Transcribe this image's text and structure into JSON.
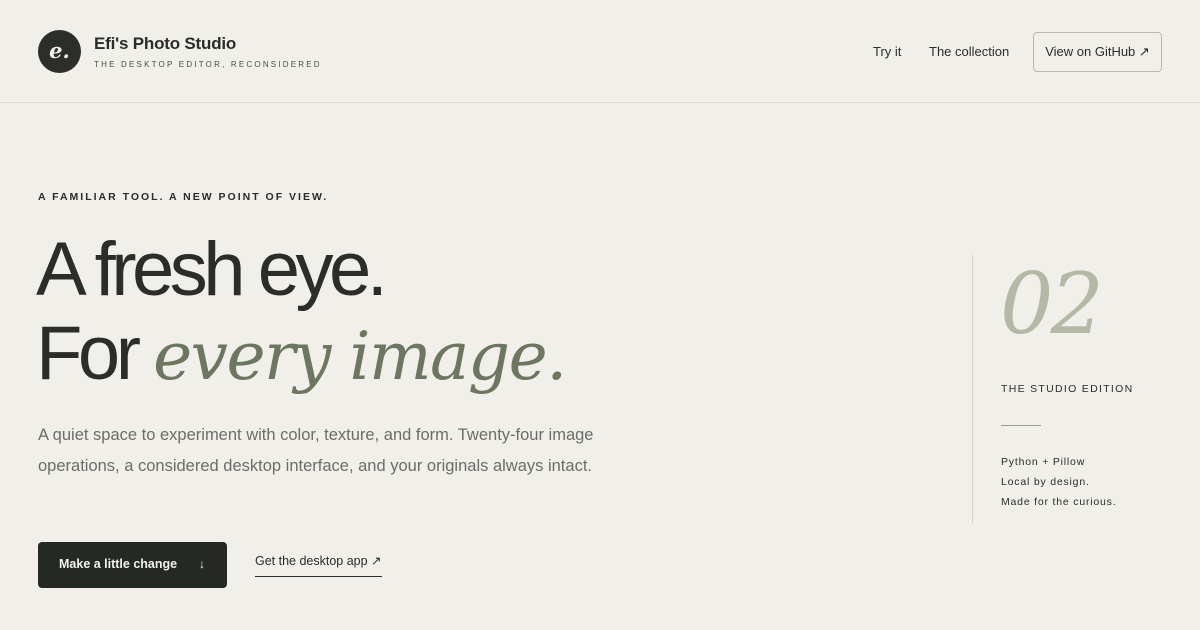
{
  "brand": {
    "logo_letter": "e.",
    "name": "Efi's Photo Studio",
    "tagline": "THE DESKTOP EDITOR, RECONSIDERED"
  },
  "nav": {
    "try_label": "Try it",
    "collection_label": "The collection",
    "github_label": "View on GitHub ↗"
  },
  "hero": {
    "eyebrow": "A FAMILIAR TOOL. A NEW POINT OF VIEW.",
    "headline_line1": "A fresh eye.",
    "headline_line2_plain": "For",
    "headline_line2_accent": "every image.",
    "body": "A quiet space to experiment with color, texture, and form. Twenty-four image operations, a considered desktop interface, and your originals always intact.",
    "primary_cta": "Make a little change",
    "primary_cta_arrow": "↓",
    "secondary_cta": "Get the desktop app ↗"
  },
  "edition": {
    "number": "02",
    "title": "THE STUDIO EDITION",
    "notes": [
      "Python + Pillow",
      "Local by design.",
      "Made for the curious."
    ]
  },
  "colors": {
    "background": "#f0efe9",
    "text": "#2a2d29",
    "accent": "#6c7660",
    "button": "#242926",
    "edition_number": "#b6b8a6"
  }
}
